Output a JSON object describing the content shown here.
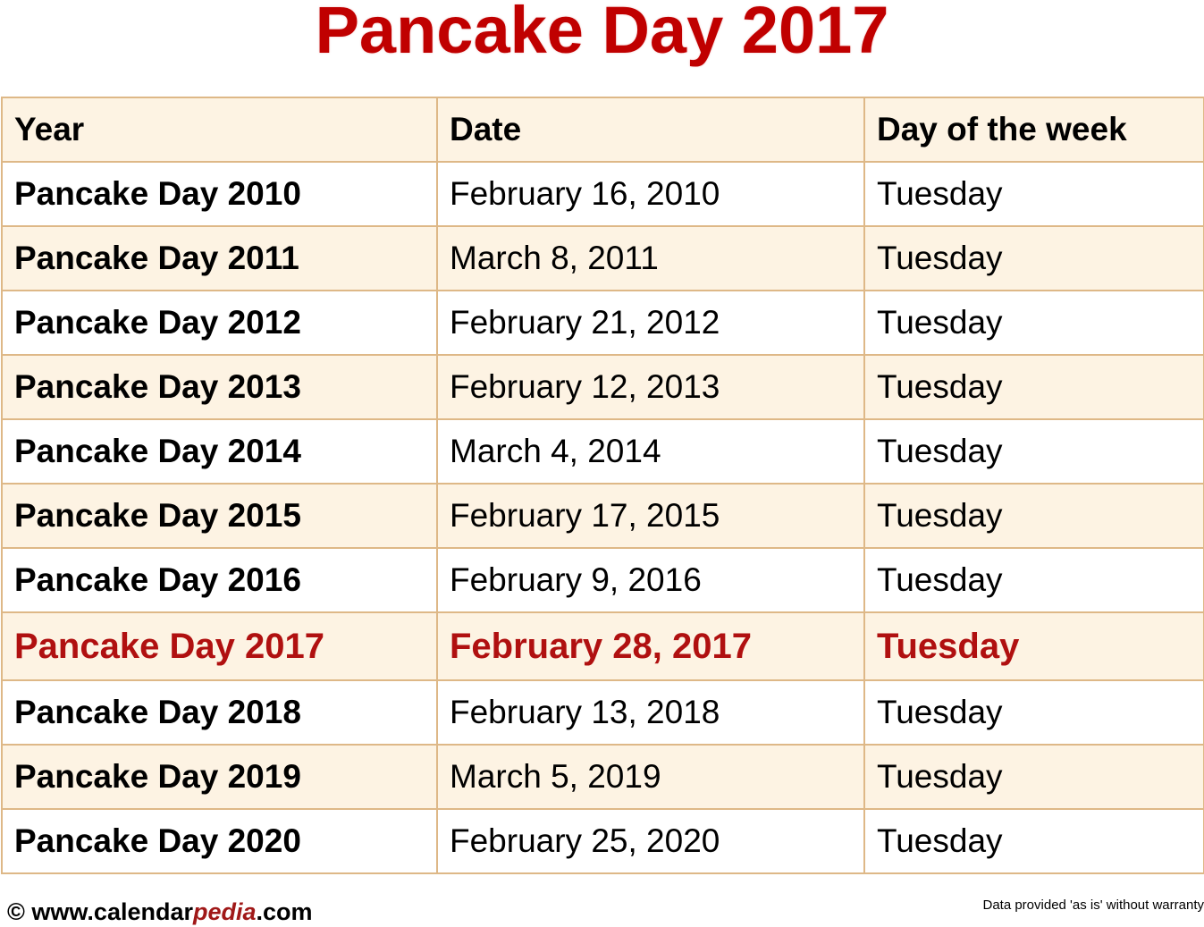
{
  "title": "Pancake Day 2017",
  "table": {
    "headers": [
      "Year",
      "Date",
      "Day of the week"
    ],
    "rows": [
      {
        "year": "Pancake Day 2010",
        "date": "February 16, 2010",
        "day": "Tuesday"
      },
      {
        "year": "Pancake Day 2011",
        "date": "March 8, 2011",
        "day": "Tuesday"
      },
      {
        "year": "Pancake Day 2012",
        "date": "February 21, 2012",
        "day": "Tuesday"
      },
      {
        "year": "Pancake Day 2013",
        "date": "February 12, 2013",
        "day": "Tuesday"
      },
      {
        "year": "Pancake Day 2014",
        "date": "March 4, 2014",
        "day": "Tuesday"
      },
      {
        "year": "Pancake Day 2015",
        "date": "February 17, 2015",
        "day": "Tuesday"
      },
      {
        "year": "Pancake Day 2016",
        "date": "February 9, 2016",
        "day": "Tuesday"
      },
      {
        "year": "Pancake Day 2017",
        "date": "February 28, 2017",
        "day": "Tuesday"
      },
      {
        "year": "Pancake Day 2018",
        "date": "February 13, 2018",
        "day": "Tuesday"
      },
      {
        "year": "Pancake Day 2019",
        "date": "March 5, 2019",
        "day": "Tuesday"
      },
      {
        "year": "Pancake Day 2020",
        "date": "February 25, 2020",
        "day": "Tuesday"
      }
    ],
    "highlighted_year": "Pancake Day 2017"
  },
  "footer": {
    "copyright_symbol": "©",
    "site_prefix": "www.calendar",
    "site_accent": "pedia",
    "site_suffix": ".com",
    "disclaimer": "Data provided 'as is' without warranty"
  },
  "colors": {
    "title": "#c00000",
    "highlight_text": "#b01010",
    "border": "#deb887",
    "alt_row": "#fdf3e3"
  }
}
